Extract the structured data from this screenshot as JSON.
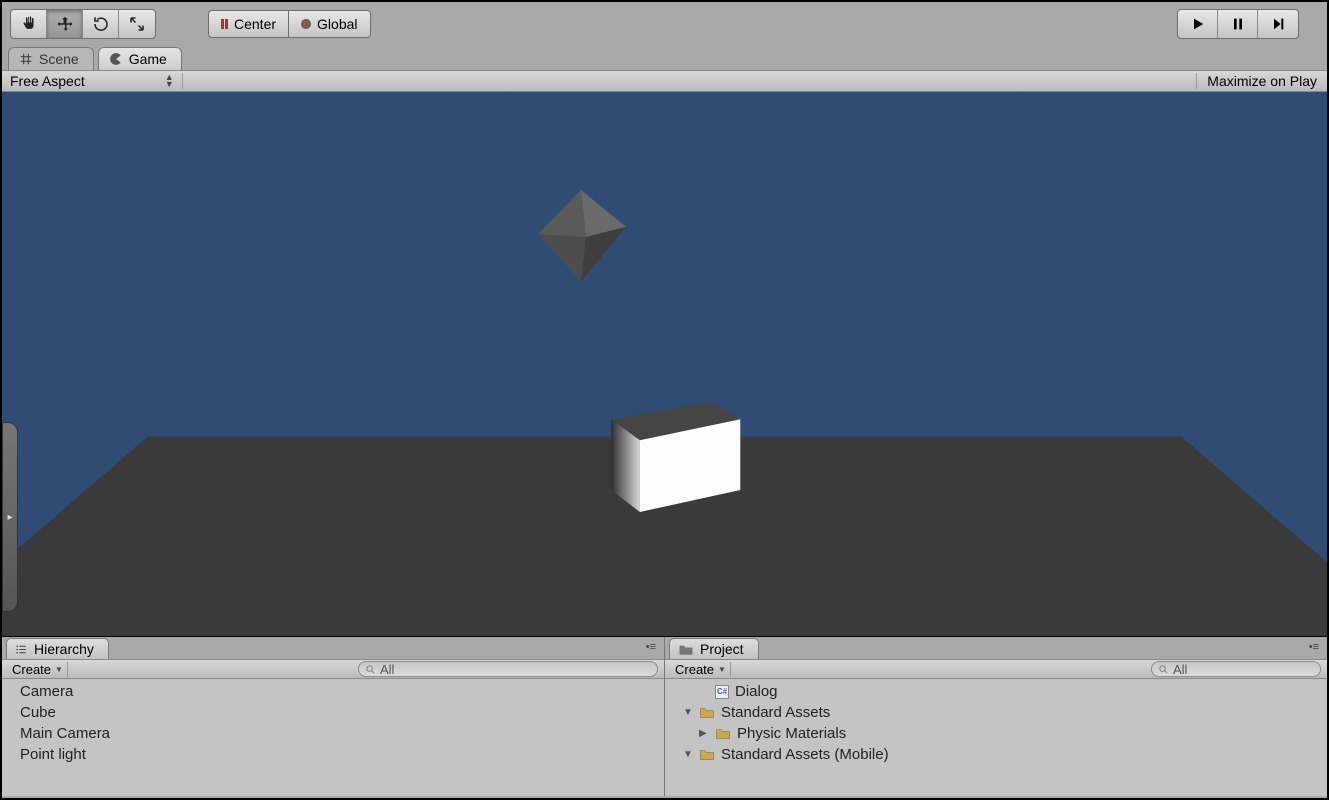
{
  "toolbar": {
    "pivot_center": "Center",
    "pivot_global": "Global"
  },
  "tabs": {
    "scene": "Scene",
    "game": "Game"
  },
  "game_options": {
    "aspect": "Free Aspect",
    "maximize": "Maximize on Play"
  },
  "hierarchy": {
    "tab_label": "Hierarchy",
    "create_label": "Create",
    "search_placeholder": "All",
    "items": [
      "Camera",
      "Cube",
      "Main Camera",
      "Point light"
    ]
  },
  "project": {
    "tab_label": "Project",
    "create_label": "Create",
    "search_placeholder": "All",
    "tree": {
      "0": {
        "name": "Dialog"
      },
      "1": {
        "name": "Standard Assets"
      },
      "2": {
        "name": "Physic Materials"
      },
      "3": {
        "name": "Standard Assets (Mobile)"
      }
    }
  }
}
